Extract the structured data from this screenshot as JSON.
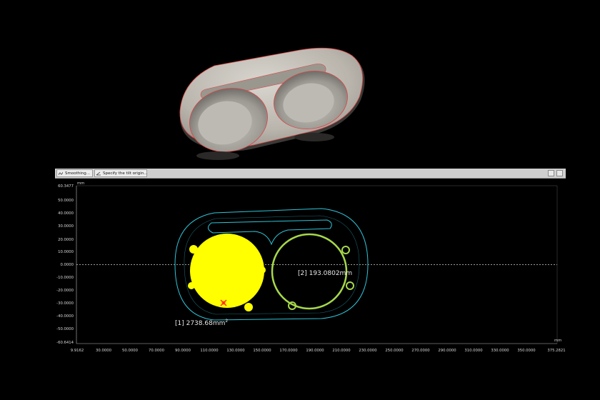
{
  "toolbar": {
    "buttons": [
      {
        "label": "Smoothing..."
      },
      {
        "label": "Specify the tilt origin..."
      }
    ]
  },
  "plot": {
    "y_unit": "mm",
    "x_unit": "mm",
    "y_ticks": [
      "60.3477",
      "50.0000",
      "40.0000",
      "30.0000",
      "20.0000",
      "10.0000",
      "0.0000",
      "-10.0000",
      "-20.0000",
      "-30.0000",
      "-40.0000",
      "-50.0000",
      "-60.6414"
    ],
    "x_ticks": [
      "9.9162",
      "30.0000",
      "50.0000",
      "70.0000",
      "90.0000",
      "110.0000",
      "130.0000",
      "150.0000",
      "170.0000",
      "190.0000",
      "210.0000",
      "230.0000",
      "250.0000",
      "270.0000",
      "290.0000",
      "310.0000",
      "330.0000",
      "350.0000",
      "375.2821"
    ],
    "annotations": {
      "area_value": "[1] 2738.68mm",
      "area_sup": "2",
      "length_label": "[2] 193.0802mm"
    },
    "colors": {
      "outline": "#2ec4d8",
      "fill_region": "#ffff00",
      "ring": "#a6d84a",
      "marker": "#ff2a2a"
    }
  }
}
